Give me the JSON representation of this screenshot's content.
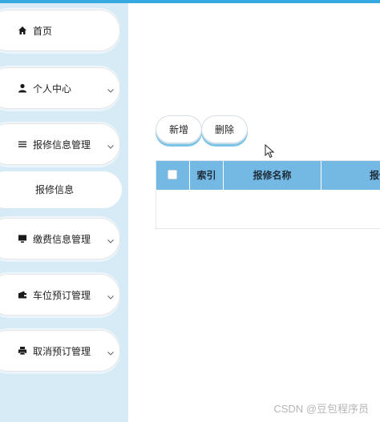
{
  "sidebar": {
    "items": [
      {
        "label": "首页",
        "icon": "home-icon"
      },
      {
        "label": "个人中心",
        "icon": "user-icon"
      },
      {
        "label": "报修信息管理",
        "icon": "list-icon"
      },
      {
        "label": "缴费信息管理",
        "icon": "monitor-icon"
      },
      {
        "label": "车位预订管理",
        "icon": "wallet-icon"
      },
      {
        "label": "取消预订管理",
        "icon": "printer-icon"
      }
    ],
    "submenu": {
      "label": "报修信息"
    }
  },
  "toolbar": {
    "add_label": "新增",
    "delete_label": "删除"
  },
  "table": {
    "columns": [
      "索引",
      "报修名称",
      "报修"
    ]
  },
  "watermark": "CSDN @豆包程序员",
  "colors": {
    "accent": "#35a9e0",
    "sidebar_bg": "#d7ebf7",
    "table_header": "#73b9e3"
  }
}
